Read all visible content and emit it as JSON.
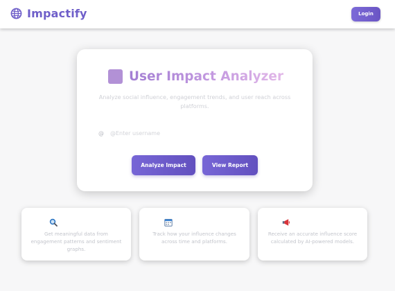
{
  "header": {
    "brand": "Impactify",
    "login_label": "Login"
  },
  "analyzer": {
    "title": "User Impact Analyzer",
    "subtitle": "Analyze social influence, engagement trends, and user reach across platforms.",
    "input_prefix": "@",
    "input_placeholder": "@Enter username",
    "input_value": "",
    "analyze_label": "Analyze Impact",
    "report_label": "View Report"
  },
  "features": [
    {
      "icon": "magnifier-icon",
      "text": "Get meaningful data from engagement patterns and sentiment graphs."
    },
    {
      "icon": "calendar-icon",
      "text": "Track how your influence changes across time and platforms."
    },
    {
      "icon": "megaphone-icon",
      "text": "Receive an accurate influence score calculated by AI-powered models."
    }
  ],
  "colors": {
    "brand": "#6f5fc9",
    "button": "#6b59c9",
    "title_gradient_start": "#a27ed3",
    "title_gradient_end": "#e2b8e8",
    "muted_text": "#c2c4cb"
  }
}
